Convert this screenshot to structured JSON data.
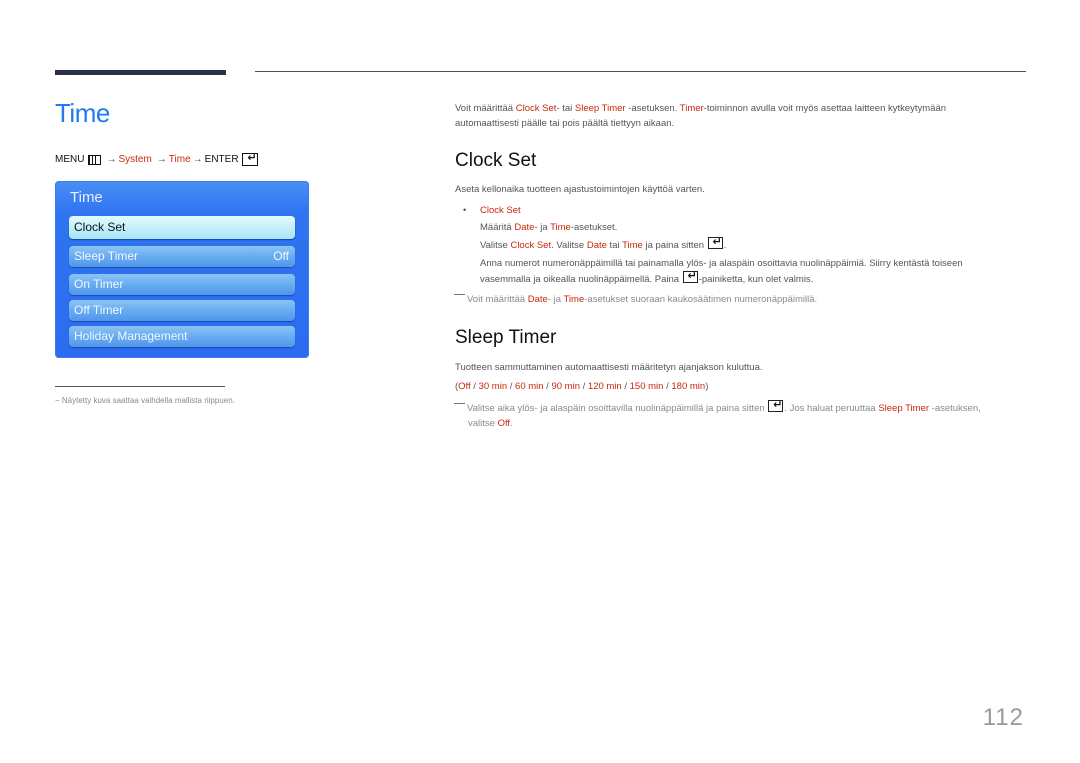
{
  "header": {
    "title": "Time"
  },
  "menu_path": {
    "menu": "MENU",
    "system": "System",
    "time": "Time",
    "enter": "ENTER",
    "arrow": "→"
  },
  "tv_menu": {
    "title": "Time",
    "items": [
      {
        "label": "Clock Set",
        "value": "",
        "selected": true
      },
      {
        "label": "Sleep Timer",
        "value": "Off",
        "selected": false
      },
      {
        "label": "On Timer",
        "value": "",
        "selected": false
      },
      {
        "label": "Off Timer",
        "value": "",
        "selected": false
      },
      {
        "label": "Holiday Management",
        "value": "",
        "selected": false
      }
    ]
  },
  "footnote": "−  Näytetty kuva saattaa vaihdella mallista riippuen.",
  "intro": {
    "p1": "Voit määrittää ",
    "clock_set": "Clock Set",
    "p2": "- tai ",
    "sleep_timer": "Sleep Timer",
    "p3": " -asetuksen. ",
    "timer": "Timer",
    "p4": "-toiminnon avulla voit myös asettaa laitteen kytkeytymään",
    "p5": "automaattisesti päälle tai pois päältä tiettyyn aikaan."
  },
  "clock_set": {
    "heading": "Clock Set",
    "desc": "Aseta kellonaika tuotteen ajastustoimintojen käyttöä varten.",
    "bullet_label": "Clock Set",
    "line1_a": "Määritä ",
    "date": "Date",
    "line1_b": "- ja ",
    "time": "Time",
    "line1_c": "-asetukset.",
    "line2_a": "Valitse ",
    "clock_set_word": "Clock Set",
    "line2_b": ". Valitse ",
    "line2_c": " tai ",
    "line2_d": " ja paina sitten ",
    "line2_e": ".",
    "line3": "Anna numerot numeronäppäimillä tai painamalla ylös- ja alaspäin osoittavia nuolinäppäimiä. Siirry kentästä toiseen",
    "line4_a": "vasemmalla ja oikealla nuolinäppäimellä. Paina ",
    "line4_b": "-painiketta, kun olet valmis.",
    "note_a": "Voit määrittää ",
    "note_b": "- ja ",
    "note_c": "-asetukset suoraan kaukosäätimen numeronäppäimillä."
  },
  "sleep_timer": {
    "heading": "Sleep Timer",
    "desc": "Tuotteen sammuttaminen automaattisesti määritetyn ajanjakson kuluttua.",
    "options": [
      "Off",
      "30 min",
      "60 min",
      "90 min",
      "120 min",
      "150 min",
      "180 min"
    ],
    "note_a": "Valitse aika ylös- ja alaspäin osoittavilla nuolinäppäimillä ja paina sitten ",
    "note_b": ". Jos haluat peruuttaa ",
    "sleep_timer_word": "Sleep Timer",
    "note_c": " -asetuksen,",
    "note_d": "valitse ",
    "off_word": "Off",
    "note_e": "."
  },
  "page_number": "112",
  "colors": {
    "accent_blue": "#1e7cf2",
    "highlight_red": "#c8280a"
  }
}
